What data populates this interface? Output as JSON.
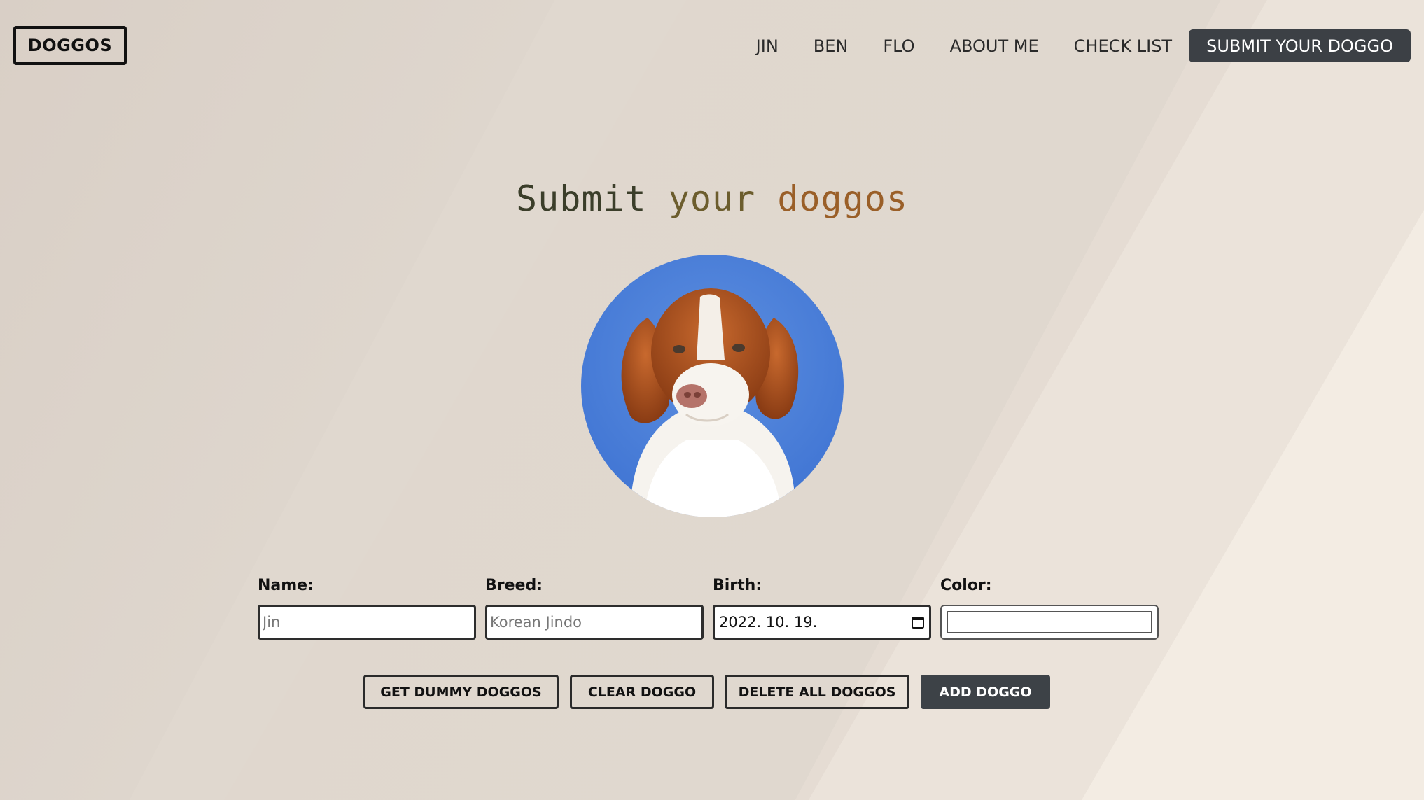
{
  "header": {
    "logo_text": "DOGGOS",
    "nav": {
      "jin": "JIN",
      "ben": "BEN",
      "flo": "FLO",
      "about": "ABOUT ME",
      "checklist": "CHECK LIST",
      "submit": "SUBMIT YOUR DOGGO"
    }
  },
  "main": {
    "title_part1": "Submit",
    "title_part2": "your",
    "title_part3": "doggos",
    "form": {
      "name_label": "Name:",
      "name_placeholder": "Jin",
      "breed_label": "Breed:",
      "breed_placeholder": "Korean Jindo",
      "birth_label": "Birth:",
      "birth_value": "2022. 10. 19.",
      "color_label": "Color:",
      "color_value": "#ffffff"
    },
    "buttons": {
      "dummy": "GET DUMMY DOGGOS",
      "clear": "CLEAR DOGGO",
      "delete_all": "DELETE ALL DOGGOS",
      "add": "ADD DOGGO"
    }
  },
  "colors": {
    "background": "#ded5cc",
    "dark_button": "#3d4247",
    "title_dark": "#3b3e2a",
    "title_olive": "#6c5d2d",
    "title_brown": "#9a5f28"
  }
}
